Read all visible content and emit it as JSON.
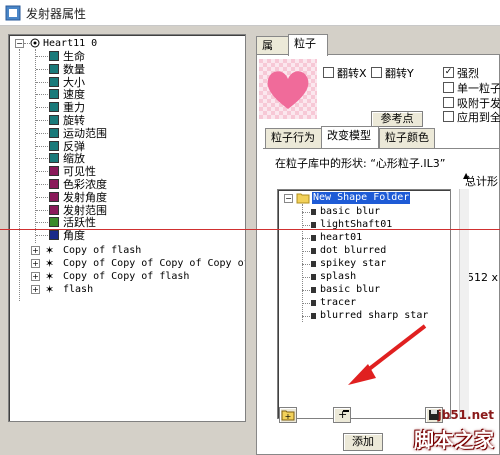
{
  "window": {
    "title": "发射器属性"
  },
  "left_tree": {
    "root": "Heart11 0",
    "properties": [
      {
        "label": "生命",
        "color": "#1a7a7a"
      },
      {
        "label": "数量",
        "color": "#1a7a7a"
      },
      {
        "label": "大小",
        "color": "#1a7a7a"
      },
      {
        "label": "速度",
        "color": "#1a7a7a"
      },
      {
        "label": "重力",
        "color": "#1a7a7a"
      },
      {
        "label": "旋转",
        "color": "#1a7a7a"
      },
      {
        "label": "运动范围",
        "color": "#1a7a7a"
      },
      {
        "label": "反弹",
        "color": "#1a7a7a"
      },
      {
        "label": "缩放",
        "color": "#1a7a7a"
      },
      {
        "label": "可见性",
        "color": "#8a1a5a"
      },
      {
        "label": "色彩浓度",
        "color": "#8a1a5a"
      },
      {
        "label": "发射角度",
        "color": "#8a1a5a"
      },
      {
        "label": "发射范围",
        "color": "#8a1a5a"
      },
      {
        "label": "活跃性",
        "color": "#3a8a2a"
      },
      {
        "label": "角度",
        "color": "#1a2a8a"
      }
    ],
    "children": [
      "Copy of flash",
      "Copy of Copy of Copy of Copy of",
      "Copy of Copy of flash",
      "flash"
    ]
  },
  "tabs_top": [
    {
      "label": "属性"
    },
    {
      "label": "粒子"
    }
  ],
  "particle_options": {
    "flip_x": "翻转X",
    "flip_y": "翻转Y",
    "strong": "强烈",
    "single": "单一粒子",
    "attach": "吸附于发",
    "apply_all": "应用到全",
    "reference_point": "参考点"
  },
  "tabs_sub": [
    {
      "label": "粒子行为"
    },
    {
      "label": "改变模型"
    },
    {
      "label": "粒子颜色"
    }
  ],
  "library_label": "在粒子库中的形状: “心形粒子.IL3”",
  "total_label": "总计形",
  "size_label": "512 x",
  "library_tree": {
    "folder": "New Shape Folder",
    "items": [
      "basic blur",
      "lightShaft01",
      "heart01",
      "dot blurred",
      "spikey star",
      "splash",
      "basic blur",
      "tracer",
      "blurred sharp star"
    ]
  },
  "add_button": "添加",
  "watermark": {
    "url": "jb51.net",
    "name": "脚本之家"
  },
  "colors": {
    "teal": "#1a7a7a",
    "magenta": "#8a1a5a",
    "green": "#3a8a2a",
    "blue": "#1a2a8a",
    "folder_highlight": "#1e5bd6",
    "heart": "#f06b9a"
  }
}
